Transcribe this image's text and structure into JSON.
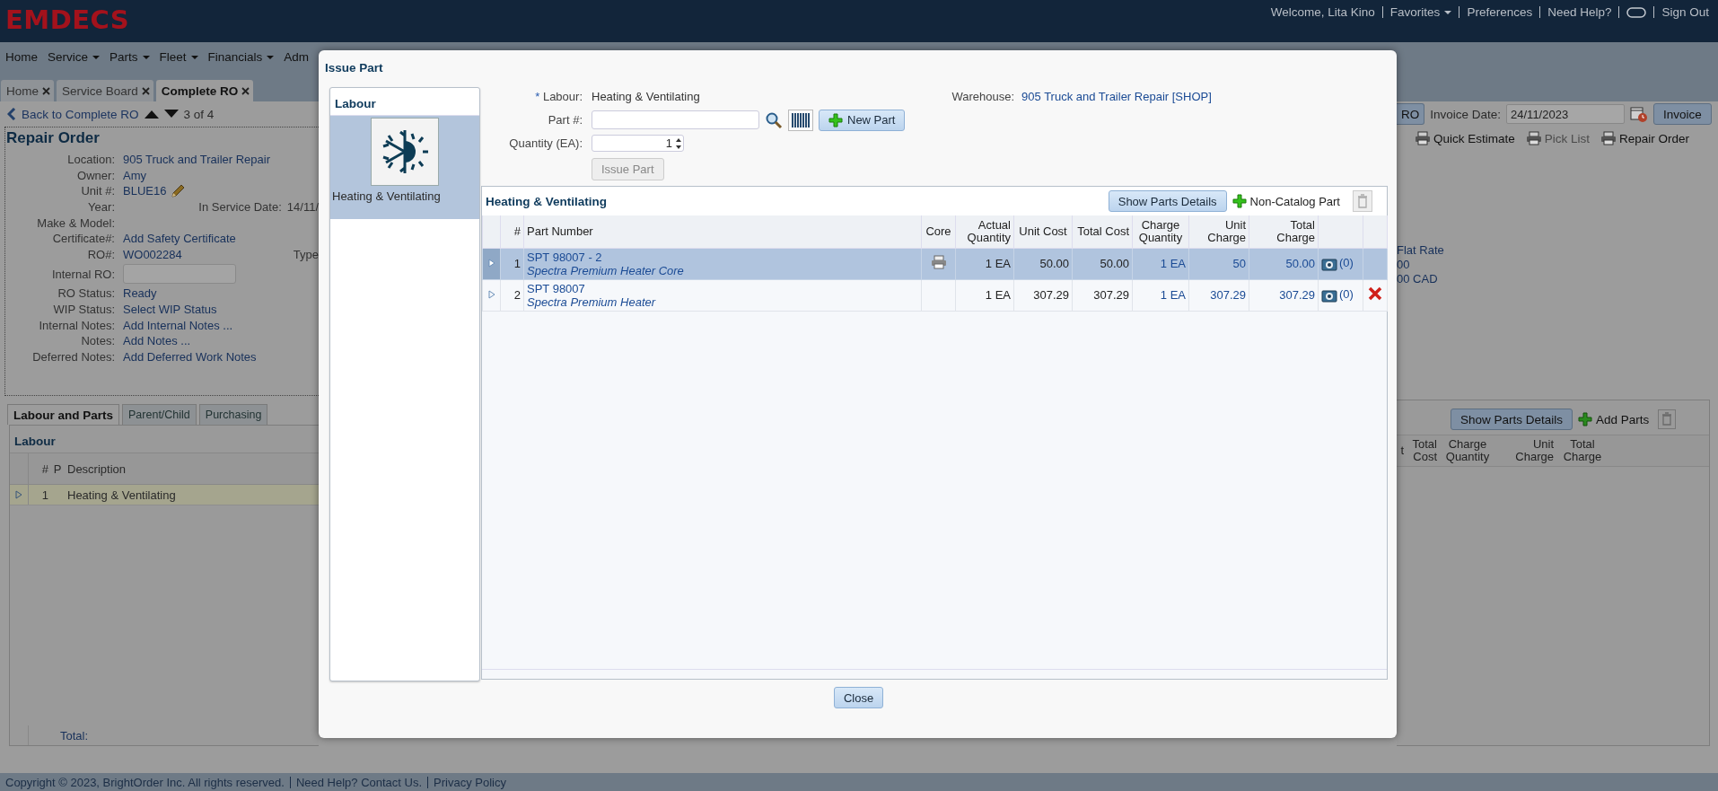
{
  "header": {
    "logo": "EMDECS",
    "user_links": [
      {
        "kind": "text",
        "label": "Welcome, Lita Kino"
      },
      {
        "kind": "menu",
        "label": "Favorites"
      },
      {
        "kind": "link",
        "label": "Preferences"
      },
      {
        "kind": "link",
        "label": "Need Help?"
      },
      {
        "kind": "toggle"
      },
      {
        "kind": "link",
        "label": "Sign Out"
      }
    ]
  },
  "nav": [
    {
      "label": "Home",
      "menu": false
    },
    {
      "label": "Service",
      "menu": true
    },
    {
      "label": "Parts",
      "menu": true
    },
    {
      "label": "Fleet",
      "menu": true
    },
    {
      "label": "Financials",
      "menu": true
    },
    {
      "label": "Adm",
      "menu": false
    }
  ],
  "tabs": [
    {
      "label": "Home",
      "selected": false
    },
    {
      "label": "Service Board",
      "selected": false
    },
    {
      "label": "Complete RO",
      "selected": true
    }
  ],
  "record_nav": {
    "back": "Back to Complete RO",
    "position": "3 of 4"
  },
  "repair_order": {
    "title": "Repair Order",
    "fields": [
      {
        "kind": "text",
        "label": "Location:",
        "value": "905 Truck and Trailer Repair"
      },
      {
        "kind": "text",
        "label": "Owner:",
        "value": "Amy"
      },
      {
        "kind": "editable",
        "label": "Unit #:",
        "value": "BLUE16"
      },
      {
        "kind": "text",
        "label": "Year:",
        "aside_label": "In Service Date:",
        "aside_value": "14/11/"
      },
      {
        "kind": "text",
        "label": "Make & Model:"
      },
      {
        "kind": "text",
        "label": "Certificate#:",
        "value": "Add Safety Certificate"
      },
      {
        "kind": "text",
        "label": "RO#:",
        "value": "WO002284",
        "aside_label": "Type"
      },
      {
        "kind": "input",
        "label": "Internal RO:"
      },
      {
        "kind": "text",
        "label": "RO Status:",
        "value": "Ready"
      },
      {
        "kind": "text",
        "label": "WIP Status:",
        "value": "Select WIP Status"
      },
      {
        "kind": "text",
        "label": "Internal Notes:",
        "value": "Add Internal Notes ..."
      },
      {
        "kind": "text",
        "label": "Notes:",
        "value": "Add Notes ..."
      },
      {
        "kind": "text",
        "label": "Deferred Notes:",
        "value": "Add Deferred Work Notes"
      }
    ]
  },
  "lower_tabs": [
    {
      "label": "Labour and Parts",
      "selected": true
    },
    {
      "label": "Parent/Child",
      "selected": false
    },
    {
      "label": "Purchasing",
      "selected": false
    }
  ],
  "labour_panel": {
    "title": "Labour",
    "columns": [
      "#",
      "P",
      "Description"
    ],
    "rows": [
      {
        "num": "1",
        "description": "Heating & Ventilating",
        "selected": true
      }
    ],
    "total_label": "Total:"
  },
  "invoice": {
    "ro_button": "RO",
    "date_label": "Invoice Date:",
    "date": "24/11/2023",
    "button": "Invoice"
  },
  "print_links": [
    {
      "label": "Quick Estimate",
      "disabled": false
    },
    {
      "label": "Pick List",
      "disabled": true
    },
    {
      "label": "Repair Order",
      "disabled": false
    }
  ],
  "rate_fragment": [
    "Flat Rate",
    "00",
    "00 CAD"
  ],
  "parts_panel": {
    "details_button": "Show Parts Details",
    "add_button": "Add Parts",
    "columns": [
      "t",
      "Total Cost",
      "Charge Quantity",
      "Unit Charge",
      "Total Charge"
    ]
  },
  "footer": {
    "copyright": "Copyright © 2023, BrightOrder Inc. All rights reserved.",
    "links": [
      "Need Help? Contact Us.",
      "Privacy Policy"
    ]
  },
  "dialog": {
    "title": "Issue Part",
    "labour_list": {
      "title": "Labour",
      "items": [
        {
          "label": "Heating & Ventilating",
          "selected": true
        }
      ]
    },
    "form": {
      "required_mark": "*",
      "labour_label": "Labour:",
      "labour_value": "Heating & Ventilating",
      "part_label": "Part #:",
      "quantity_label": "Quantity (EA):",
      "quantity": "1",
      "new_part": "New Part",
      "issue_button": "Issue Part",
      "issue_disabled": true,
      "warehouse_label": "Warehouse:",
      "warehouse": "905 Truck and Trailer Repair [SHOP]"
    },
    "parts": {
      "title": "Heating & Ventilating",
      "details_button": "Show Parts Details",
      "add_button": "Non-Catalog Part",
      "columns": [
        "#",
        "Part Number",
        "Core",
        "Actual Quantity",
        "Unit Cost",
        "Total Cost",
        "Charge Quantity",
        "Unit Charge",
        "Total Charge"
      ],
      "rows": [
        {
          "selected": true,
          "num": "1",
          "part": "SPT 98007 - 2",
          "description": "Spectra Premium Heater Core",
          "core": true,
          "actual_qty": "1 EA",
          "unit_cost": "50.00",
          "total_cost": "50.00",
          "charge_qty": "1 EA",
          "unit_charge": "50",
          "total_charge": "50.00",
          "photos": "(0)",
          "deletable": false
        },
        {
          "selected": false,
          "num": "2",
          "part": "SPT 98007",
          "description": "Spectra Premium Heater",
          "core": false,
          "actual_qty": "1 EA",
          "unit_cost": "307.29",
          "total_cost": "307.29",
          "charge_qty": "1 EA",
          "unit_charge": "307.29",
          "total_charge": "307.29",
          "photos": "(0)",
          "deletable": true
        }
      ]
    },
    "close": "Close"
  }
}
